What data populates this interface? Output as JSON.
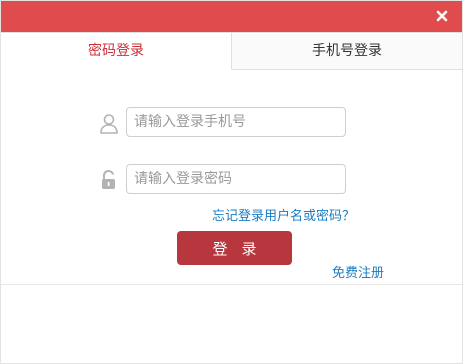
{
  "titlebar": {
    "close_icon": "close-icon",
    "accent_color": "#e04b4d"
  },
  "tabs": [
    {
      "label": "密码登录",
      "active": true
    },
    {
      "label": "手机号登录",
      "active": false
    }
  ],
  "form": {
    "phone_placeholder": "请输入登录手机号",
    "phone_icon": "user-icon",
    "password_placeholder": "请输入登录密码",
    "password_icon": "lock-icon",
    "forgot_link": "忘记登录用户名或密码？",
    "login_button": "登录",
    "register_link": "免费注册"
  },
  "colors": {
    "active_tab_text": "#c8323a",
    "button_bg": "#b8363e",
    "link": "#1a7cc4"
  }
}
